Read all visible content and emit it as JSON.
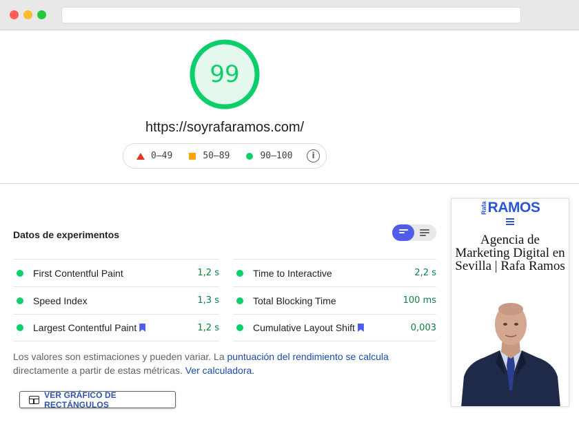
{
  "report": {
    "score": "99",
    "score_fraction": 0.99,
    "score_color": "#0cce6b",
    "url": "https://soyrafaramos.com/"
  },
  "legend": {
    "fail": "0–49",
    "average": "50–89",
    "pass": "90–100",
    "info_icon": "info-icon"
  },
  "metrics": {
    "title": "Datos de experimentos",
    "left": [
      {
        "name": "First Contentful Paint",
        "value": "1,2 s",
        "bookmark": false
      },
      {
        "name": "Speed Index",
        "value": "1,3 s",
        "bookmark": false
      },
      {
        "name": "Largest Contentful Paint",
        "value": "1,2 s",
        "bookmark": true
      }
    ],
    "right": [
      {
        "name": "Time to Interactive",
        "value": "2,2 s",
        "bookmark": false
      },
      {
        "name": "Total Blocking Time",
        "value": "100 ms",
        "bookmark": false
      },
      {
        "name": "Cumulative Layout Shift",
        "value": "0,003",
        "bookmark": true
      }
    ],
    "note_text": "Los valores son estimaciones y pueden variar. La ",
    "note_link1": "puntuación del rendimiento se calcula",
    "note_mid": " directamente a partir de estas métricas. ",
    "note_link2": "Ver calculadora.",
    "treemap_button": "VER GRÁFICO DE RECTÁNGULOS"
  },
  "thumbnail": {
    "logo_small": "Rafa",
    "logo_big": "RAMOS",
    "headline": "Agencia de Marketing Digital en Sevilla | Rafa Ramos",
    "brand_color": "#2b54d6"
  }
}
